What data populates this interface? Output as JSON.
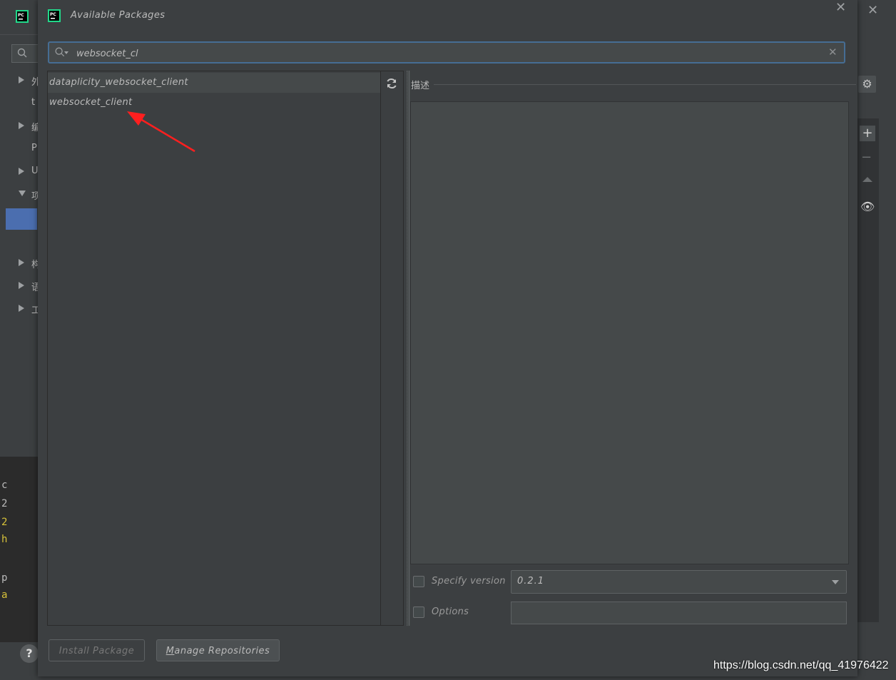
{
  "background": {
    "tree_items": [
      "外",
      "t",
      "编",
      "P",
      "U",
      "项",
      "构",
      "语",
      "工"
    ],
    "console_lines": [
      "c",
      "2",
      "2",
      "h",
      "p",
      "a"
    ],
    "help_label": "?"
  },
  "dialog": {
    "title": "Available Packages",
    "search": {
      "value": "websocket_cl",
      "placeholder": ""
    },
    "packages": [
      "dataplicity_websocket_client",
      "websocket_client"
    ],
    "description_label": "描述",
    "specify_version_label": "Specify version",
    "version_value": "0.2.1",
    "options_label": "Options",
    "install_button": "Install Package",
    "manage_button": "Manage Repositories"
  },
  "watermark": "https://blog.csdn.net/qq_41976422",
  "colors": {
    "accent": "#466d94",
    "selection": "#4b6eaf",
    "annotation_arrow": "#ff1f1f"
  }
}
